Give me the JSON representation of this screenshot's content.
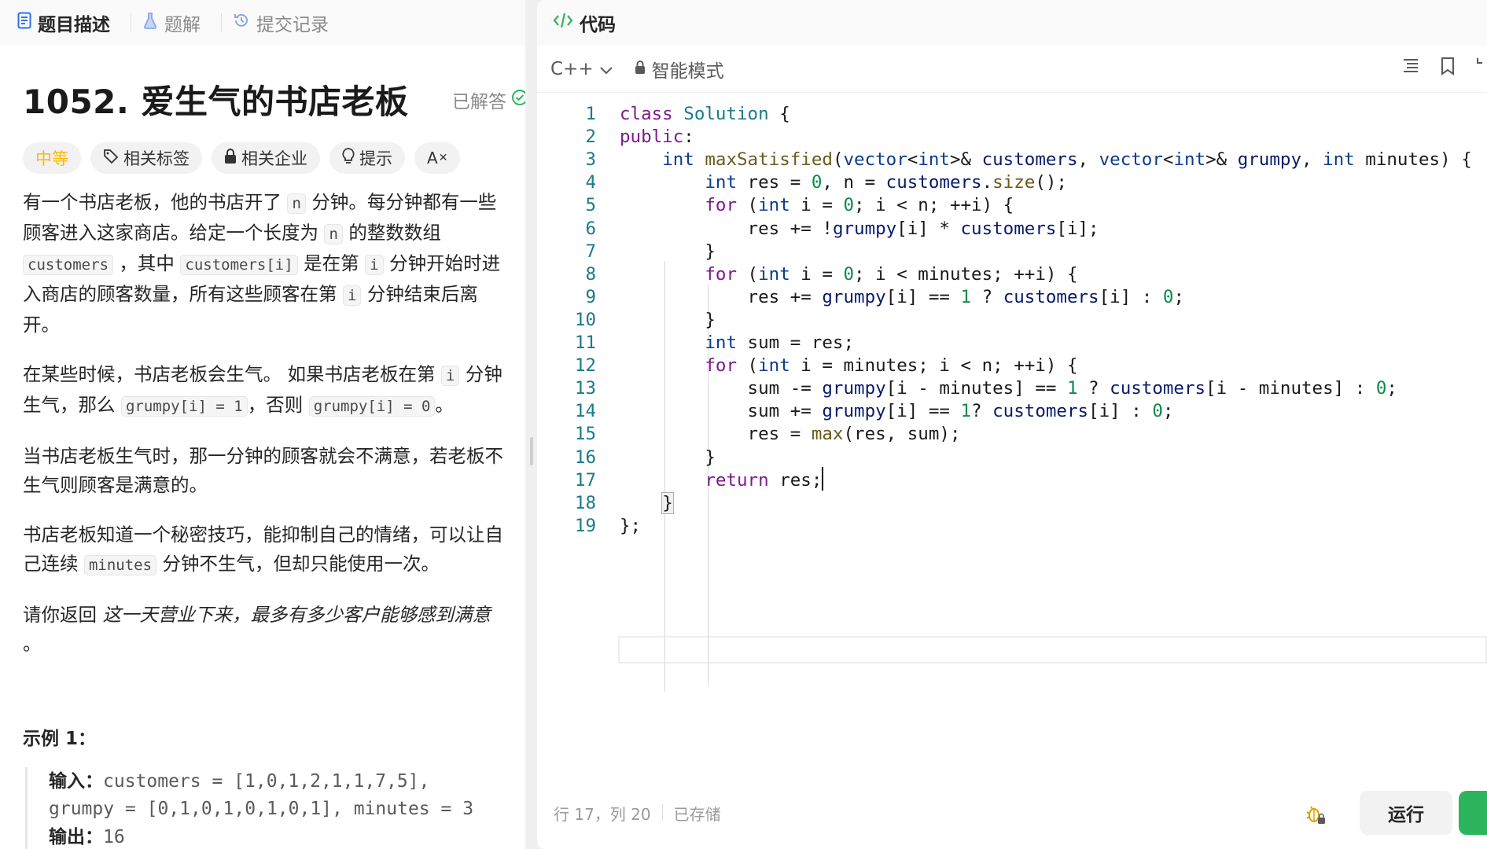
{
  "left_tabs": [
    {
      "label": "题目描述",
      "icon": "description-icon"
    },
    {
      "label": "题解",
      "icon": "flask-icon"
    },
    {
      "label": "提交记录",
      "icon": "history-icon"
    }
  ],
  "problem": {
    "title": "1052. 爱生气的书店老板",
    "status": "已解答",
    "tags": {
      "difficulty": "中等",
      "topics": "相关标签",
      "companies": "相关企业",
      "hint": "提示",
      "translate": "A"
    },
    "desc": {
      "p1": [
        "有一个书店老板，他的书店开了 ",
        "n",
        " 分钟。每分钟都有一些顾客进入这家商店。给定一个长度为 ",
        "n",
        " 的整数数组 ",
        "customers",
        " ，其中 ",
        "customers[i]",
        " 是在第 ",
        "i",
        " 分钟开始时进入商店的顾客数量，所有这些顾客在第 ",
        "i",
        " 分钟结束后离开。"
      ],
      "p2": [
        "在某些时候，书店老板会生气。 如果书店老板在第 ",
        "i",
        " 分钟生气，那么 ",
        "grumpy[i] = 1",
        "，否则 ",
        "grumpy[i] = 0",
        "。"
      ],
      "p3": "当书店老板生气时，那一分钟的顾客就会不满意，若老板不生气则顾客是满意的。",
      "p4": [
        "书店老板知道一个秘密技巧，能抑制自己的情绪，可以让自己连续 ",
        "minutes",
        " 分钟不生气，但却只能使用一次。"
      ],
      "p5": [
        "请你返回 ",
        "这一天营业下来，最多有多少客户能够感到满意",
        "。"
      ]
    },
    "example": {
      "title": "示例 1：",
      "input_label": "输入：",
      "input_line1": "customers = [1,0,1,2,1,1,7,5],",
      "input_line2": "grumpy = [0,1,0,1,0,1,0,1], minutes = 3",
      "output_label": "输出：",
      "output": "16"
    }
  },
  "editor": {
    "header": "代码",
    "language": "C++",
    "mode": "智能模式",
    "code_lines": [
      "class Solution {",
      "public:",
      "    int maxSatisfied(vector<int>& customers, vector<int>& grumpy, int minutes) {",
      "        int res = 0, n = customers.size();",
      "        for (int i = 0; i < n; ++i) {",
      "            res += !grumpy[i] * customers[i];",
      "        }",
      "        for (int i = 0; i < minutes; ++i) {",
      "            res += grumpy[i] == 1 ? customers[i] : 0;",
      "        }",
      "        int sum = res;",
      "        for (int i = minutes; i < n; ++i) {",
      "            sum -= grumpy[i - minutes] == 1 ? customers[i - minutes] : 0;",
      "            sum += grumpy[i] == 1? customers[i] : 0;",
      "            res = max(res, sum);",
      "        }",
      "        return res;",
      "    }",
      "};"
    ],
    "line_numbers": [
      "1",
      "2",
      "3",
      "4",
      "5",
      "6",
      "7",
      "8",
      "9",
      "10",
      "11",
      "12",
      "13",
      "14",
      "15",
      "16",
      "17",
      "18",
      "19"
    ],
    "status": {
      "position": "行 17，列 20",
      "saved": "已存储"
    },
    "run_label": "运行"
  }
}
